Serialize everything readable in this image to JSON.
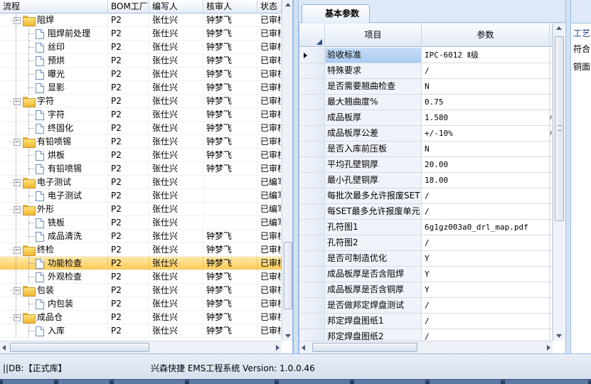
{
  "tree_grid": {
    "headers": [
      "流程",
      "BOM工厂",
      "编写人",
      "核审人",
      "状态"
    ],
    "rows": [
      {
        "level": 1,
        "type": "folder",
        "name": "阻焊",
        "bom": "P2",
        "writer": "张仕兴",
        "reviewer": "钟梦飞",
        "status": "已审核",
        "selected": false
      },
      {
        "level": 2,
        "type": "doc",
        "name": "阻焊前处理",
        "bom": "P2",
        "writer": "张仕兴",
        "reviewer": "钟梦飞",
        "status": "已审核",
        "selected": false
      },
      {
        "level": 2,
        "type": "doc",
        "name": "丝印",
        "bom": "P2",
        "writer": "张仕兴",
        "reviewer": "钟梦飞",
        "status": "已审核",
        "selected": false
      },
      {
        "level": 2,
        "type": "doc",
        "name": "预烘",
        "bom": "P2",
        "writer": "张仕兴",
        "reviewer": "钟梦飞",
        "status": "已审核",
        "selected": false
      },
      {
        "level": 2,
        "type": "doc",
        "name": "曝光",
        "bom": "P2",
        "writer": "张仕兴",
        "reviewer": "钟梦飞",
        "status": "已审核",
        "selected": false
      },
      {
        "level": 2,
        "type": "doc",
        "name": "显影",
        "bom": "P2",
        "writer": "张仕兴",
        "reviewer": "钟梦飞",
        "status": "已审核",
        "selected": false
      },
      {
        "level": 1,
        "type": "folder",
        "name": "字符",
        "bom": "P2",
        "writer": "张仕兴",
        "reviewer": "钟梦飞",
        "status": "已审核",
        "selected": false
      },
      {
        "level": 2,
        "type": "doc",
        "name": "字符",
        "bom": "P2",
        "writer": "张仕兴",
        "reviewer": "钟梦飞",
        "status": "已审核",
        "selected": false
      },
      {
        "level": 2,
        "type": "doc",
        "name": "终固化",
        "bom": "P2",
        "writer": "张仕兴",
        "reviewer": "钟梦飞",
        "status": "已审核",
        "selected": false
      },
      {
        "level": 1,
        "type": "folder",
        "name": "有铅喷锡",
        "bom": "P2",
        "writer": "张仕兴",
        "reviewer": "钟梦飞",
        "status": "已审核",
        "selected": false
      },
      {
        "level": 2,
        "type": "doc",
        "name": "烘板",
        "bom": "P2",
        "writer": "张仕兴",
        "reviewer": "钟梦飞",
        "status": "已审核",
        "selected": false
      },
      {
        "level": 2,
        "type": "doc",
        "name": "有铅喷锡",
        "bom": "P2",
        "writer": "张仕兴",
        "reviewer": "钟梦飞",
        "status": "已审核",
        "selected": false
      },
      {
        "level": 1,
        "type": "folder",
        "name": "电子测试",
        "bom": "P2",
        "writer": "张仕兴",
        "reviewer": "",
        "status": "已编写",
        "selected": false
      },
      {
        "level": 2,
        "type": "doc",
        "name": "电子测试",
        "bom": "P2",
        "writer": "张仕兴",
        "reviewer": "",
        "status": "已编写",
        "selected": false
      },
      {
        "level": 1,
        "type": "folder",
        "name": "外形",
        "bom": "P2",
        "writer": "张仕兴",
        "reviewer": "",
        "status": "已编写",
        "selected": false
      },
      {
        "level": 2,
        "type": "doc",
        "name": "铣板",
        "bom": "P2",
        "writer": "张仕兴",
        "reviewer": "",
        "status": "已编写",
        "selected": false
      },
      {
        "level": 2,
        "type": "doc",
        "name": "成品清洗",
        "bom": "P2",
        "writer": "张仕兴",
        "reviewer": "钟梦飞",
        "status": "已审核",
        "selected": false
      },
      {
        "level": 1,
        "type": "folder",
        "name": "终检",
        "bom": "P2",
        "writer": "张仕兴",
        "reviewer": "钟梦飞",
        "status": "已审核",
        "selected": false
      },
      {
        "level": 2,
        "type": "doc",
        "name": "功能检查",
        "bom": "P2",
        "writer": "张仕兴",
        "reviewer": "钟梦飞",
        "status": "已审核",
        "selected": true
      },
      {
        "level": 2,
        "type": "doc",
        "name": "外观检查",
        "bom": "P2",
        "writer": "张仕兴",
        "reviewer": "钟梦飞",
        "status": "已审核",
        "selected": false
      },
      {
        "level": 1,
        "type": "folder",
        "name": "包装",
        "bom": "P2",
        "writer": "张仕兴",
        "reviewer": "钟梦飞",
        "status": "已审核",
        "selected": false
      },
      {
        "level": 2,
        "type": "doc",
        "name": "内包装",
        "bom": "P2",
        "writer": "张仕兴",
        "reviewer": "钟梦飞",
        "status": "已审核",
        "selected": false
      },
      {
        "level": 1,
        "type": "folder",
        "name": "成品仓",
        "bom": "P2",
        "writer": "张仕兴",
        "reviewer": "钟梦飞",
        "status": "已审核",
        "selected": false
      },
      {
        "level": 2,
        "type": "doc",
        "name": "入库",
        "bom": "P2",
        "writer": "张仕兴",
        "reviewer": "钟梦飞",
        "status": "已审核",
        "selected": false
      }
    ]
  },
  "param_panel": {
    "tab_label": "基本参数",
    "headers": [
      "项目",
      "参数"
    ],
    "rows": [
      {
        "item": "验收标准",
        "value": "IPC-6012 Ⅱ级",
        "unit": "",
        "current": true
      },
      {
        "item": "特殊要求",
        "value": "/",
        "unit": "",
        "current": false
      },
      {
        "item": "是否需要翘曲检查",
        "value": "N",
        "unit": "",
        "current": false
      },
      {
        "item": "最大翘曲度%",
        "value": "0.75",
        "unit": "",
        "current": false
      },
      {
        "item": "成品板厚",
        "value": "1.580",
        "unit": "m",
        "current": false
      },
      {
        "item": "成品板厚公差",
        "value": "+/-10%",
        "unit": "m",
        "current": false
      },
      {
        "item": "是否入库前压板",
        "value": "N",
        "unit": "",
        "current": false
      },
      {
        "item": "平均孔壁铜厚",
        "value": "20.00",
        "unit": "",
        "current": false
      },
      {
        "item": "最小孔壁铜厚",
        "value": "18.00",
        "unit": "",
        "current": false
      },
      {
        "item": "每批次最多允许报废SET",
        "value": "/",
        "unit": "",
        "current": false
      },
      {
        "item": "每SET最多允许报废单元",
        "value": "/",
        "unit": "",
        "current": false
      },
      {
        "item": "孔符图1",
        "value": "6g1gz003a0_drl_map.pdf",
        "unit": "",
        "current": false
      },
      {
        "item": "孔符图2",
        "value": "/",
        "unit": "",
        "current": false
      },
      {
        "item": "是否可制造优化",
        "value": "Y",
        "unit": "",
        "current": false
      },
      {
        "item": "成品板厚是否含阻焊",
        "value": "Y",
        "unit": "",
        "current": false
      },
      {
        "item": "成品板厚是否含铜厚",
        "value": "Y",
        "unit": "",
        "current": false
      },
      {
        "item": "是否做邦定焊盘测试",
        "value": "/",
        "unit": "",
        "current": false
      },
      {
        "item": "邦定焊盘图纸1",
        "value": "/",
        "unit": "",
        "current": false
      },
      {
        "item": "邦定焊盘图纸2",
        "value": "/",
        "unit": "",
        "current": false
      }
    ]
  },
  "right_panel": {
    "title": "工艺",
    "line1": "符合",
    "line2": "铜面"
  },
  "status_bar": {
    "db": "||DB:【正式库】",
    "app": "兴森快捷 EMS工程系统 Version: 1.0.0.46"
  }
}
